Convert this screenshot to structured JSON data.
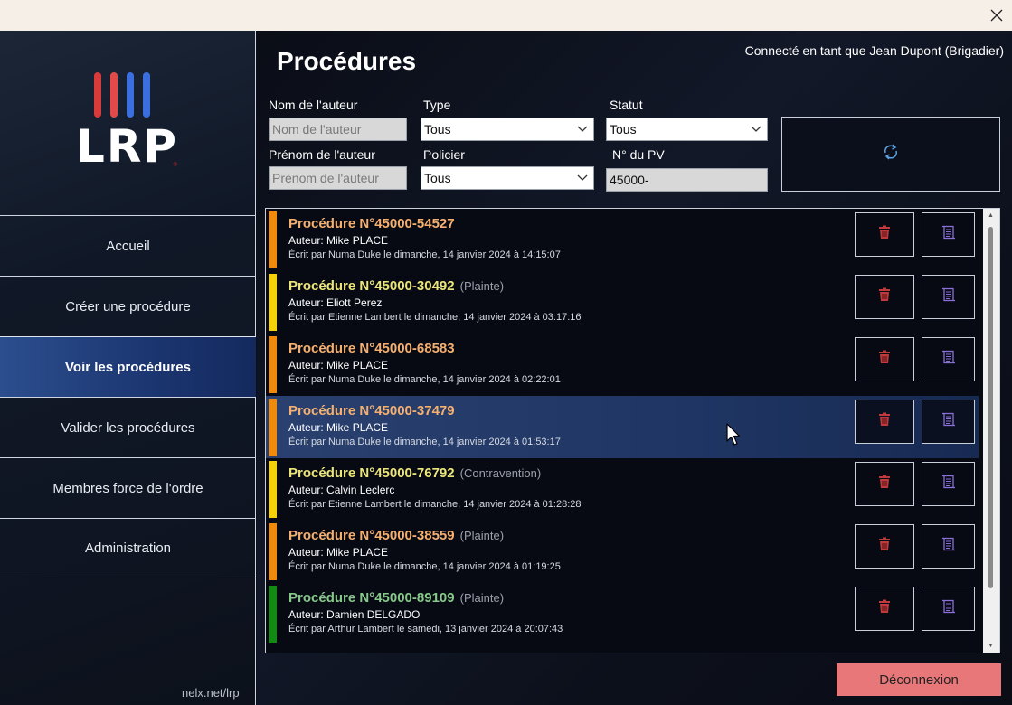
{
  "window": {
    "close_icon": "close-icon"
  },
  "sidebar": {
    "logo_text": "LRP",
    "logo_bar_colors": [
      "#d93a3a",
      "#e24a4a",
      "#3b6fe0",
      "#3b6fe0"
    ],
    "items": [
      {
        "label": "Accueil"
      },
      {
        "label": "Créer une procédure"
      },
      {
        "label": "Voir les procédures",
        "active": true
      },
      {
        "label": "Valider les procédures"
      },
      {
        "label": "Membres force de l'ordre"
      },
      {
        "label": "Administration"
      }
    ],
    "footer_link": "nelx.net/lrp"
  },
  "header": {
    "title": "Procédures",
    "connected": "Connecté en tant que Jean Dupont (Brigadier)"
  },
  "filters": {
    "author_name_label": "Nom de l'auteur",
    "author_name_placeholder": "Nom de l'auteur",
    "author_firstname_label": "Prénom de l'auteur",
    "author_firstname_placeholder": "Prénom de l'auteur",
    "type_label": "Type",
    "type_value": "Tous",
    "policier_label": "Policier",
    "policier_value": "Tous",
    "statut_label": "Statut",
    "statut_value": "Tous",
    "pv_label": "N° du PV",
    "pv_value": "45000-",
    "refresh_icon": "refresh-icon"
  },
  "procedures": [
    {
      "title": "Procédure N°45000-54527",
      "type": "",
      "author": "Auteur: Mike PLACE",
      "written": "Écrit par Numa Duke le dimanche, 14 janvier 2024 à 14:15:07",
      "bar_color": "#f08a0c",
      "title_color": "#f5b070"
    },
    {
      "title": "Procédure N°45000-30492",
      "type": "(Plainte)",
      "author": "Auteur: Eliott Perez",
      "written": "Écrit par Etienne Lambert le dimanche, 14 janvier 2024 à 03:17:16",
      "bar_color": "#f5d10a",
      "title_color": "#ece67a"
    },
    {
      "title": "Procédure N°45000-68583",
      "type": "",
      "author": "Auteur: Mike PLACE",
      "written": "Écrit par Numa Duke le dimanche, 14 janvier 2024 à 02:22:01",
      "bar_color": "#f08a0c",
      "title_color": "#f5b070"
    },
    {
      "title": "Procédure N°45000-37479",
      "type": "",
      "author": "Auteur: Mike PLACE",
      "written": "Écrit par Numa Duke le dimanche, 14 janvier 2024 à 01:53:17",
      "bar_color": "#f08a0c",
      "title_color": "#f5b070",
      "highlighted": true
    },
    {
      "title": "Procédure N°45000-76792",
      "type": "(Contravention)",
      "author": "Auteur: Calvin Leclerc",
      "written": "Écrit par Etienne Lambert le dimanche, 14 janvier 2024 à 01:28:28",
      "bar_color": "#f5d10a",
      "title_color": "#ece67a"
    },
    {
      "title": "Procédure N°45000-38559",
      "type": "(Plainte)",
      "author": "Auteur: Mike PLACE",
      "written": "Écrit par Numa Duke le dimanche, 14 janvier 2024 à 01:19:25",
      "bar_color": "#f08a0c",
      "title_color": "#f5b070"
    },
    {
      "title": "Procédure N°45000-89109",
      "type": "(Plainte)",
      "author": "Auteur: Damien DELGADO",
      "written": "Écrit par Arthur Lambert le samedi, 13 janvier 2024 à 20:07:43",
      "bar_color": "#138a13",
      "title_color": "#86c98a"
    }
  ],
  "row_icons": {
    "delete": "trash-icon",
    "view": "document-icon"
  },
  "colors": {
    "delete_icon": "#c0393d",
    "view_icon": "#8b6fd8",
    "logout_bg": "#e8777a"
  },
  "logout_label": "Déconnexion"
}
